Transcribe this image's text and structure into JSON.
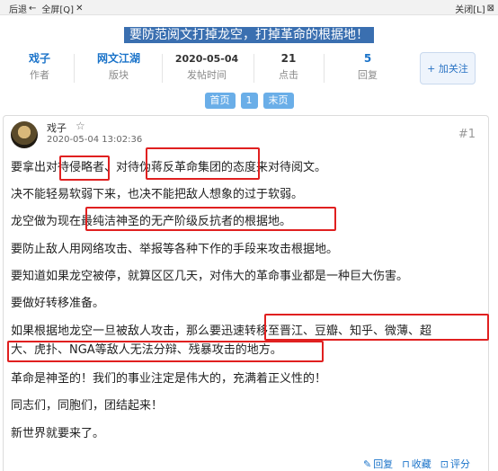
{
  "topbar": {
    "back_label": "后退",
    "fullscreen_label": "全屏[Q]",
    "close_label": "关闭[L]"
  },
  "thread": {
    "title": "要防范阅文打掉龙空，打掉革命的根据地！"
  },
  "stats": {
    "author_value": "戏子",
    "author_label": "作者",
    "board_value": "网文江湖",
    "board_label": "版块",
    "time_value": "2020-05-04",
    "time_label": "发帖时间",
    "clicks_value": "21",
    "clicks_label": "点击",
    "replies_value": "5",
    "replies_label": "回复"
  },
  "follow": {
    "label": "+ 加关注"
  },
  "pager": {
    "first": "首页",
    "current": "1",
    "last": "末页"
  },
  "post": {
    "author": "戏子",
    "date": "2020-05-04 13:02:36",
    "floor": "#1",
    "lines": [
      "要拿出对待侵略者、对待伪蒋反革命集团的态度来对待阅文。",
      "决不能轻易软弱下来，也决不能把敌人想象的过于软弱。",
      "龙空做为现在最纯洁神圣的无产阶级反抗者的根据地。",
      "要防止敌人用网络攻击、举报等各种下作的手段来攻击根据地。",
      "要知道如果龙空被停，就算区区几天，对伟大的革命事业都是一种巨大伤害。",
      "要做好转移准备。",
      "如果根据地龙空一旦被敌人攻击，那么要迅速转移至晋江、豆瓣、知乎、微薄、超",
      "大、虎扑、NGA等敌人无法分辩、残暴攻击的地方。",
      "革命是神圣的！我们的事业注定是伟大的，充满着正义性的！",
      "同志们，同胞们，团结起来！",
      "新世界就要来了。"
    ],
    "actions": {
      "reply": "回复",
      "favorite": "收藏",
      "rate": "评分"
    }
  },
  "colors": {
    "highlight": "#e02020",
    "link": "#1a73c9",
    "title_bg": "#3a6fb0"
  }
}
